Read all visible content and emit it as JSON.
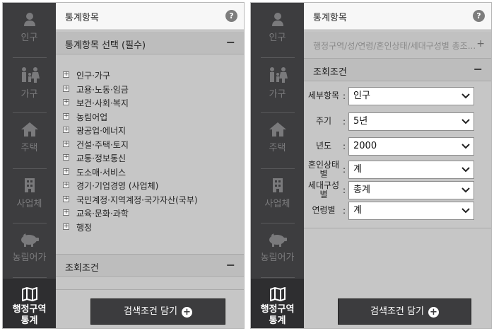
{
  "left_panel": {
    "sidebar": [
      {
        "label": "인구",
        "icon": "person-icon"
      },
      {
        "label": "가구",
        "icon": "family-icon"
      },
      {
        "label": "주택",
        "icon": "house-icon"
      },
      {
        "label": "사업체",
        "icon": "building-icon"
      },
      {
        "label": "농림어가",
        "icon": "pig-icon"
      },
      {
        "label_line1": "행정구역",
        "label_line2": "통계",
        "icon": "map-icon"
      }
    ],
    "title": "통계항목",
    "help": "?",
    "section_select": "통계항목 선택 (필수)",
    "section_conditions": "조회조건",
    "collapse": "−",
    "expand": "+",
    "tree": [
      "인구·가구",
      "고용·노동·임금",
      "보건·사회·복지",
      "농림어업",
      "광공업·에너지",
      "건설·주택·토지",
      "교통·정보통신",
      "도소매·서비스",
      "경기·기업경영 (사업체)",
      "국민계정·지역계정·국가자산(국부)",
      "교육·문화·과학",
      "행정"
    ],
    "button": "검색조건 담기",
    "button_icon": "+"
  },
  "right_panel": {
    "sidebar": [
      {
        "label": "인구",
        "icon": "person-icon"
      },
      {
        "label": "가구",
        "icon": "family-icon"
      },
      {
        "label": "주택",
        "icon": "house-icon"
      },
      {
        "label": "사업체",
        "icon": "building-icon"
      },
      {
        "label": "농림어가",
        "icon": "pig-icon"
      },
      {
        "label_line1": "행정구역",
        "label_line2": "통계",
        "icon": "map-icon"
      }
    ],
    "title": "통계항목",
    "help": "?",
    "region_text": "행정구역/성/연령/혼인상태/세대구성별 총조...",
    "region_plus": "+",
    "section_conditions": "조회조건",
    "collapse": "−",
    "conditions": [
      {
        "label": "세부항목",
        "colon": ":",
        "value": "인구"
      },
      {
        "label": "주기",
        "colon": ":",
        "value": "5년"
      },
      {
        "label": "년도",
        "colon": ":",
        "value": "2000"
      },
      {
        "label": "혼인상태별",
        "colon": ":",
        "value": "계"
      },
      {
        "label": "세대구성별",
        "colon": ":",
        "value": "총계"
      },
      {
        "label": "연령별",
        "colon": ":",
        "value": "계"
      }
    ],
    "button": "검색조건 담기",
    "button_icon": "+"
  },
  "colors": {
    "sidebar_bg": "#3d3d3f",
    "content_bg": "#c6c6c6",
    "button_bg": "#3c3c3e"
  }
}
